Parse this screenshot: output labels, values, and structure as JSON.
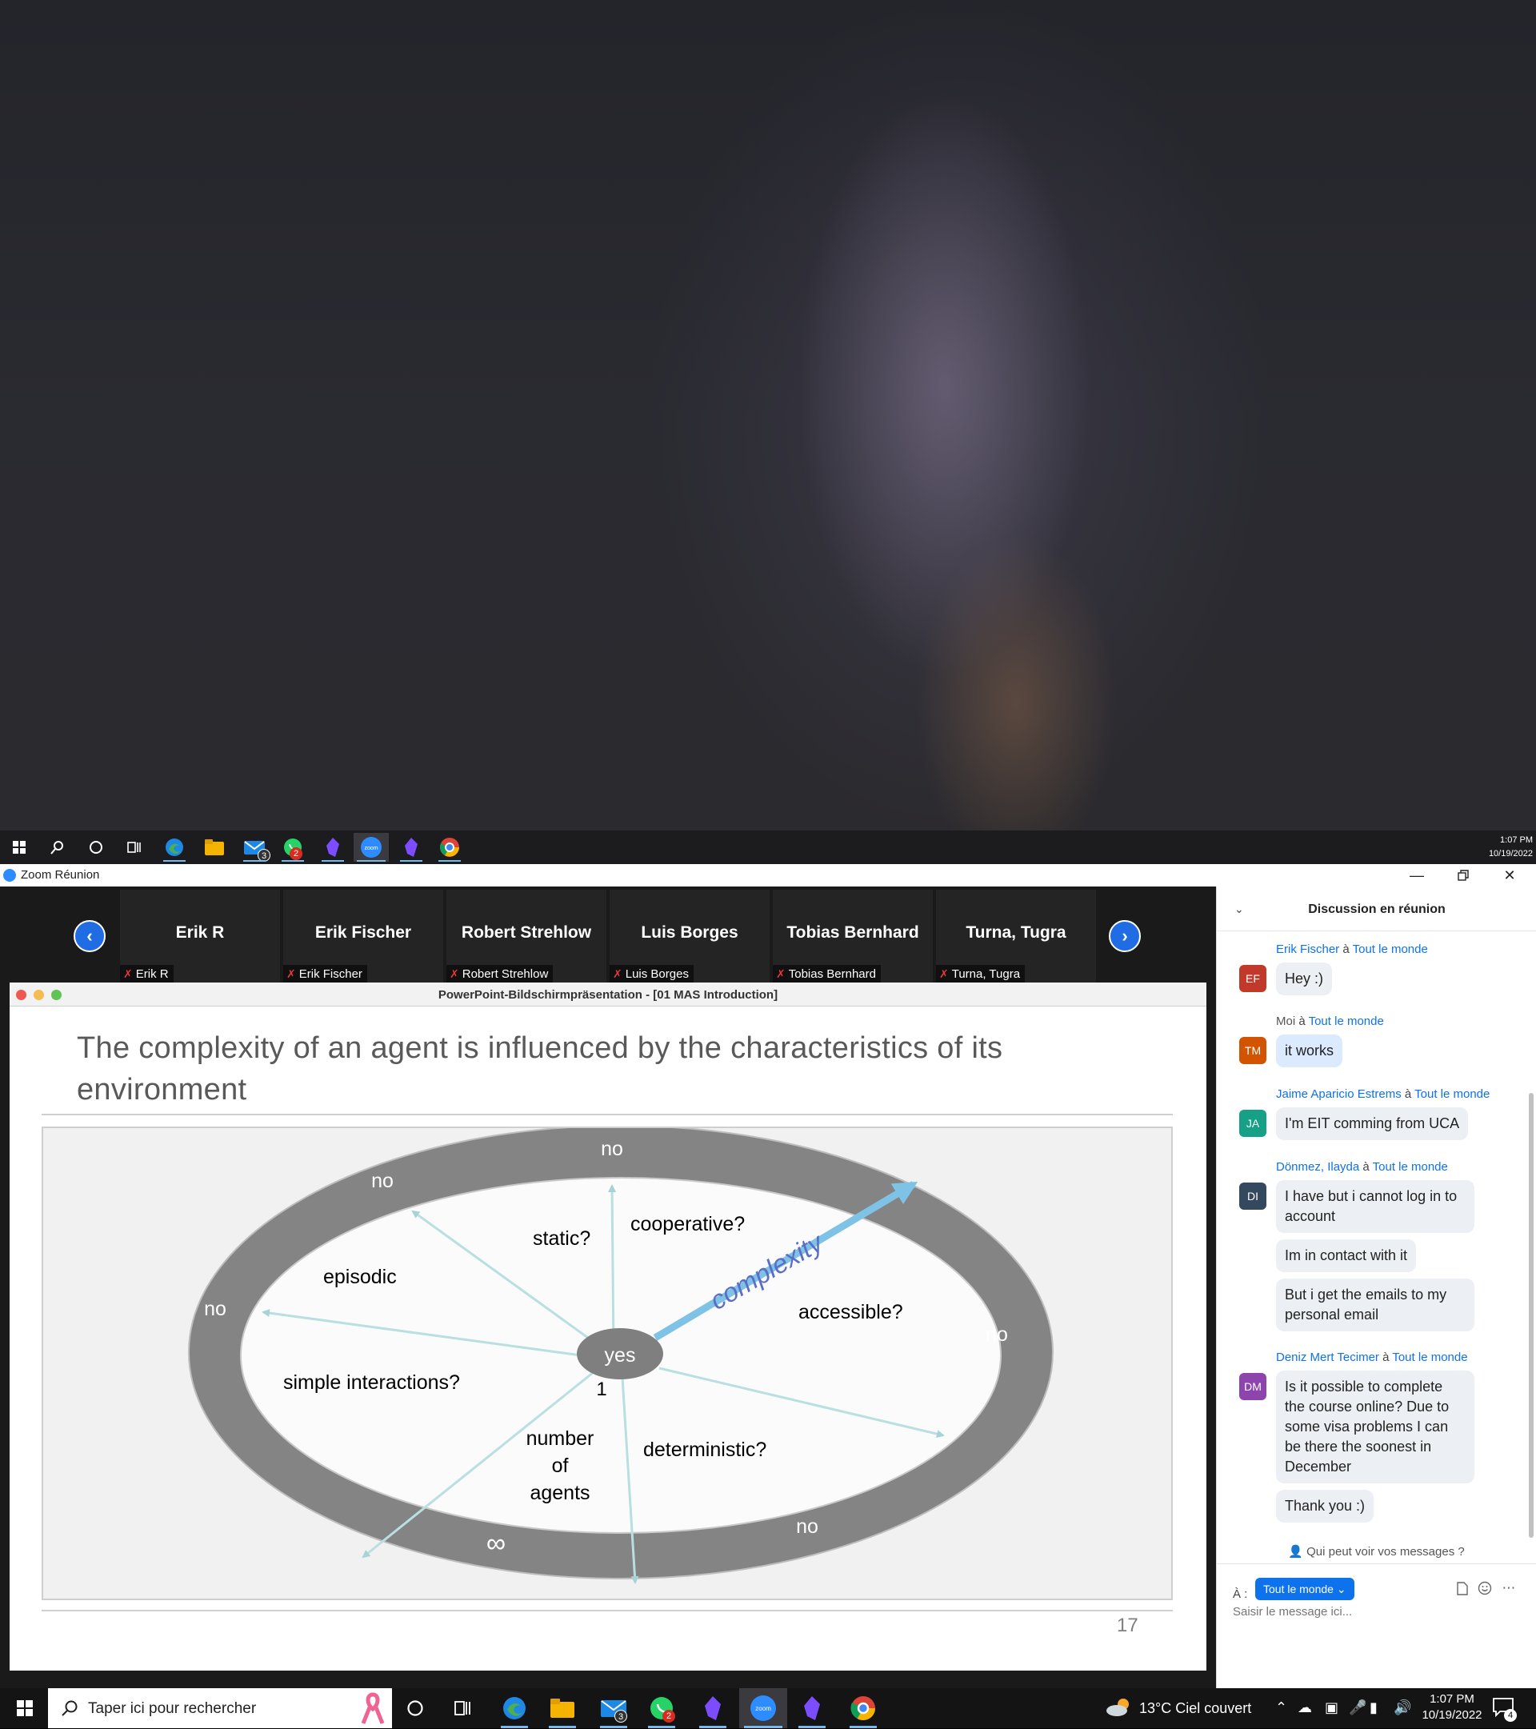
{
  "top_monitor": {
    "clock": {
      "time": "1:07 PM",
      "date": "10/19/2022"
    },
    "taskbar_badges": {
      "mail": "3",
      "whatsapp": "2"
    },
    "zoom_icon_text": "zoom"
  },
  "zoom": {
    "window_title": "Zoom Réunion",
    "gallery": {
      "participants": [
        {
          "name": "Erik R",
          "label": "Erik R"
        },
        {
          "name": "Erik Fischer",
          "label": "Erik Fischer"
        },
        {
          "name": "Robert Strehlow",
          "label": "Robert Strehlow"
        },
        {
          "name": "Luis Borges",
          "label": "Luis Borges"
        },
        {
          "name": "Tobias Bernhard",
          "label": "Tobias Bernhard"
        },
        {
          "name": "Turna, Tugra",
          "label": "Turna, Tugra"
        }
      ]
    },
    "share_title": "PowerPoint-Bildschirmpräsentation - [01 MAS Introduction]",
    "slide": {
      "title": "The complexity of an agent is influenced by the characteristics of its environment",
      "page_number": "17",
      "diagram": {
        "center": "yes",
        "center_number": "1",
        "arrow_label": "complexity",
        "questions": {
          "static": "static?",
          "cooperative": "cooperative?",
          "episodic": "episodic",
          "accessible": "accessible?",
          "simple_interactions": "simple interactions?",
          "number_of_agents_1": "number",
          "number_of_agents_2": "of",
          "number_of_agents_3": "agents",
          "deterministic": "deterministic?"
        },
        "ring_labels": {
          "top": "no",
          "top_left": "no",
          "left": "no",
          "right": "no",
          "bottom_right": "no",
          "bottom_left": "∞"
        }
      }
    },
    "chat": {
      "title": "Discussion en réunion",
      "to_word": "à",
      "everyone": "Tout le monde",
      "messages": [
        {
          "sender": "Erik Fischer",
          "initials": "EF",
          "color": "#c0392b",
          "texts": [
            "Hey :)"
          ]
        },
        {
          "sender": "Moi",
          "initials": "TM",
          "color": "#d35400",
          "texts": [
            "it works"
          ]
        },
        {
          "sender": "Jaime Aparicio Estrems",
          "initials": "JA",
          "color": "#16a085",
          "texts": [
            "I'm EIT comming from UCA"
          ]
        },
        {
          "sender": "Dönmez, Ilayda",
          "initials": "DI",
          "color": "#34495e",
          "texts": [
            "I have but i cannot log in to account",
            "Im in contact with it",
            "But i get the emails to my personal email"
          ]
        },
        {
          "sender": "Deniz Mert Tecimer",
          "initials": "DM",
          "color": "#8e44ad",
          "texts": [
            "Is it possible to complete the course online? Due to some visa problems I can be there the soonest in December",
            "Thank you :)"
          ]
        }
      ],
      "who_sees": "Qui peut voir vos messages ?",
      "to_label": "À :",
      "to_value": "Tout le monde",
      "input_placeholder": "Saisir le message ici..."
    }
  },
  "bottom_taskbar": {
    "search_placeholder": "Taper ici pour rechercher",
    "weather": "13°C  Ciel couvert",
    "clock": {
      "time": "1:07 PM",
      "date": "10/19/2022"
    },
    "mail_badge": "3",
    "whatsapp_badge": "2",
    "notification_count": "4",
    "zoom_icon_text": "zoom"
  }
}
